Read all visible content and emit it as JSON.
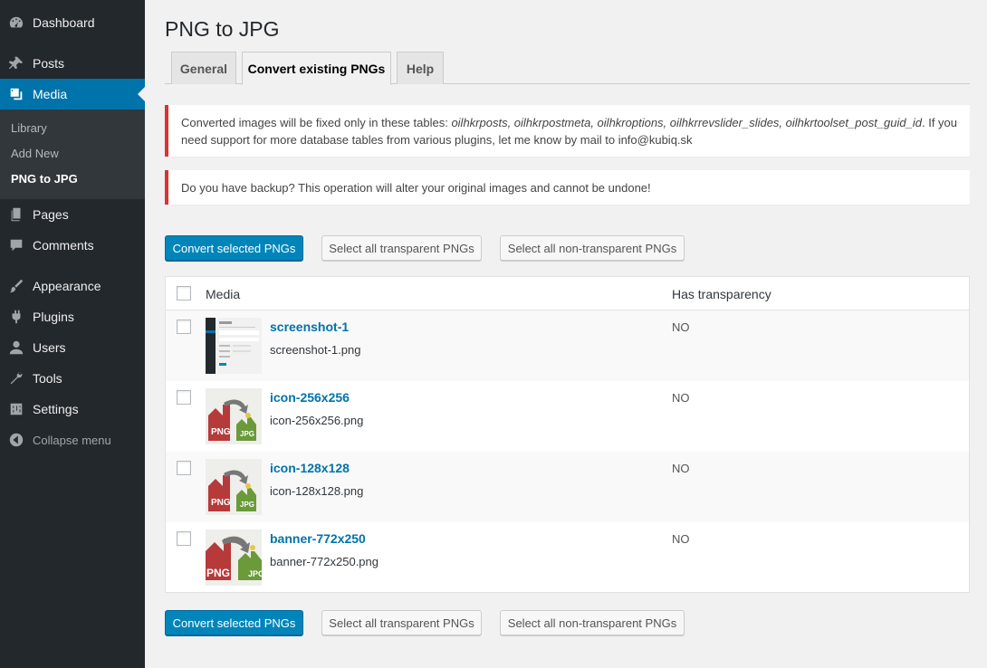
{
  "sidebar": {
    "items": [
      {
        "label": "Dashboard",
        "icon": "dashboard-icon"
      },
      {
        "label": "Posts",
        "icon": "pin-icon"
      },
      {
        "label": "Media",
        "icon": "media-icon"
      },
      {
        "label": "Pages",
        "icon": "pages-icon"
      },
      {
        "label": "Comments",
        "icon": "comments-icon"
      },
      {
        "label": "Appearance",
        "icon": "brush-icon"
      },
      {
        "label": "Plugins",
        "icon": "plugin-icon"
      },
      {
        "label": "Users",
        "icon": "users-icon"
      },
      {
        "label": "Tools",
        "icon": "wrench-icon"
      },
      {
        "label": "Settings",
        "icon": "settings-icon"
      }
    ],
    "submenu": [
      "Library",
      "Add New",
      "PNG to JPG"
    ],
    "collapse_label": "Collapse menu"
  },
  "page": {
    "title": "PNG to JPG",
    "tabs": [
      "General",
      "Convert existing PNGs",
      "Help"
    ]
  },
  "notices": {
    "tables_prefix": "Converted images will be fixed only in these tables: ",
    "tables": "oilhkrposts, oilhkrpostmeta, oilhkroptions, oilhkrrevslider_slides, oilhkrtoolset_post_guid_id",
    "tables_suffix": ". If you need support for more database tables from various plugins, let me know by mail to info@kubiq.sk",
    "backup": "Do you have backup? This operation will alter your original images and cannot be undone!"
  },
  "buttons": {
    "convert": "Convert selected PNGs",
    "select_transparent": "Select all transparent PNGs",
    "select_non_transparent": "Select all non-transparent PNGs"
  },
  "table": {
    "headers": [
      "Media",
      "Has transparency"
    ],
    "rows": [
      {
        "title": "screenshot-1",
        "file": "screenshot-1.png",
        "transparency": "NO"
      },
      {
        "title": "icon-256x256",
        "file": "icon-256x256.png",
        "transparency": "NO"
      },
      {
        "title": "icon-128x128",
        "file": "icon-128x128.png",
        "transparency": "NO"
      },
      {
        "title": "banner-772x250",
        "file": "banner-772x250.png",
        "transparency": "NO"
      }
    ]
  },
  "thumb_labels": {
    "png": "PNG",
    "jpg": "JPG"
  },
  "colors": {
    "sidebar_bg": "#23282d",
    "active_menu": "#0073aa",
    "primary_button": "#0085ba",
    "notice_error": "#dc3232",
    "link": "#0073aa"
  }
}
